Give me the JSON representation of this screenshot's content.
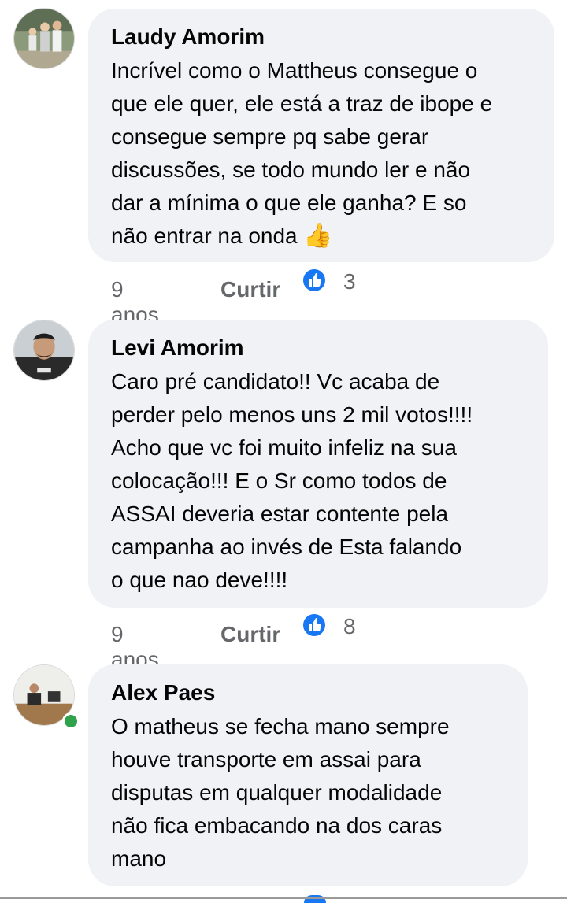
{
  "comments": [
    {
      "author": "Laudy Amorim",
      "text": "Incrível como o Mattheus consegue o\nque ele quer, ele está a traz de ibope e\nconsegue sempre pq sabe gerar\ndiscussões, se todo mundo ler e não\ndar a mínima o que ele ganha? E so\nnão entrar na onda ",
      "emoji": "👍",
      "time": "9 anos",
      "like_label": "Curtir",
      "reaction_count": "3",
      "reaction_icon": "thumbs-up-icon"
    },
    {
      "author": "Levi Amorim",
      "text": "Caro pré candidato!! Vc acaba de\nperder pelo menos uns 2 mil votos!!!!\nAcho que vc foi muito infeliz na sua\ncolocação!!! E o Sr como todos de\nASSAI deveria estar contente pela\ncampanha ao invés de Esta  falando\no que nao deve!!!!",
      "time": "9 anos",
      "like_label": "Curtir",
      "reaction_count": "8",
      "reaction_icon": "thumbs-up-icon"
    },
    {
      "author": "Alex Paes",
      "text": "O matheus se fecha mano sempre\nhouve transporte em assai para\ndisputas em qualquer modalidade\nnão fica  embacando na dos caras\nmano",
      "online": true
    }
  ],
  "colors": {
    "bubble": "#f0f2f5",
    "meta_text": "#65676b",
    "like_blue": "#1877f2",
    "online_green": "#31a24c"
  }
}
